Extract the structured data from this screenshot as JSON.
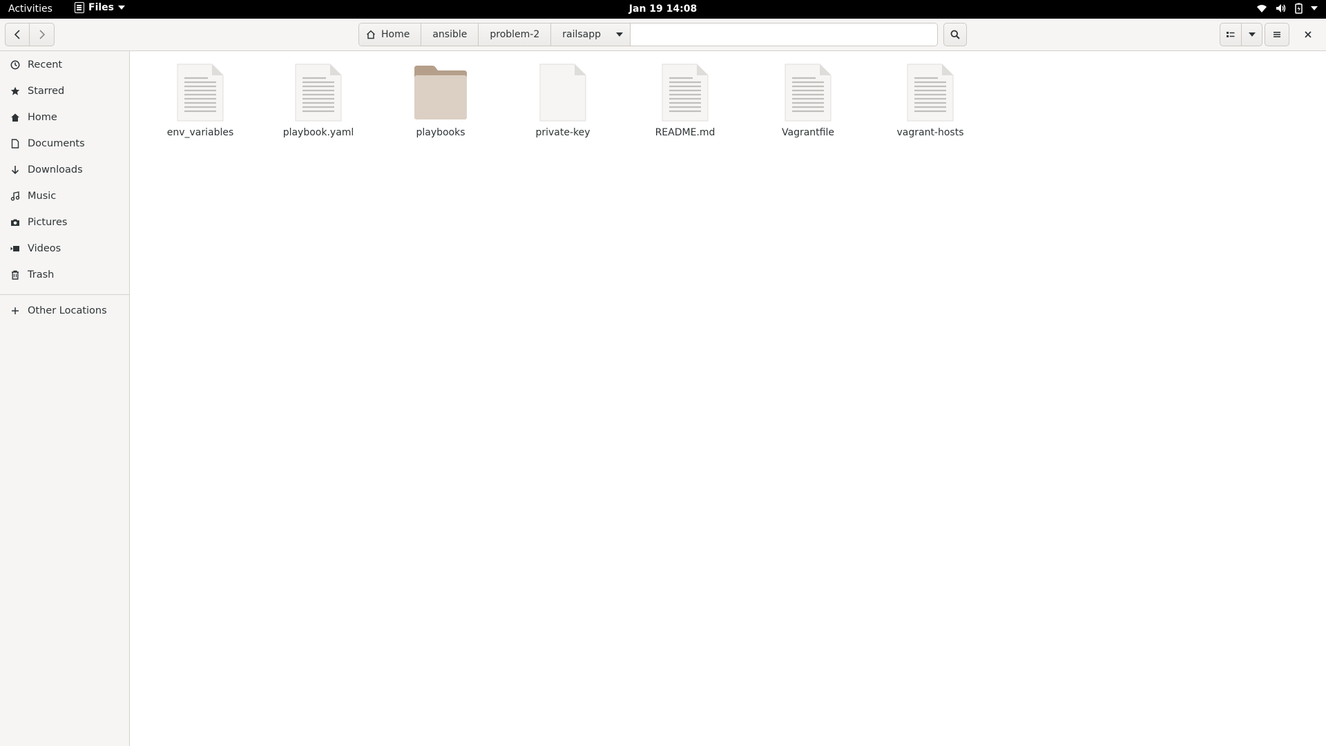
{
  "topbar": {
    "activities": "Activities",
    "app_name": "Files",
    "clock": "Jan 19  14:08",
    "status_icons": [
      "wifi-icon",
      "volume-icon",
      "battery-icon",
      "system-menu-caret-icon"
    ]
  },
  "headerbar": {
    "back_icon": "go-back-icon",
    "forward_icon": "go-forward-icon",
    "path": [
      {
        "label": "Home",
        "icon": "home-icon"
      },
      {
        "label": "ansible"
      },
      {
        "label": "problem-2"
      },
      {
        "label": "railsapp"
      }
    ],
    "search_icon": "search-icon",
    "view_icon": "list-view-icon",
    "view_options_icon": "chevron-down-icon",
    "menu_icon": "hamburger-menu-icon",
    "close_icon": "close-icon"
  },
  "sidebar": {
    "items": [
      {
        "label": "Recent",
        "icon": "clock-icon"
      },
      {
        "label": "Starred",
        "icon": "star-icon"
      },
      {
        "label": "Home",
        "icon": "home-icon"
      },
      {
        "label": "Documents",
        "icon": "document-icon"
      },
      {
        "label": "Downloads",
        "icon": "download-icon"
      },
      {
        "label": "Music",
        "icon": "music-icon"
      },
      {
        "label": "Pictures",
        "icon": "camera-icon"
      },
      {
        "label": "Videos",
        "icon": "video-icon"
      },
      {
        "label": "Trash",
        "icon": "trash-icon"
      }
    ],
    "other_locations": {
      "label": "Other Locations",
      "icon": "plus-icon"
    }
  },
  "files": [
    {
      "name": "env_variables",
      "type": "text"
    },
    {
      "name": "playbook.yaml",
      "type": "text"
    },
    {
      "name": "playbooks",
      "type": "folder"
    },
    {
      "name": "private-key",
      "type": "blank"
    },
    {
      "name": "README.md",
      "type": "text"
    },
    {
      "name": "Vagrantfile",
      "type": "text"
    },
    {
      "name": "vagrant-hosts",
      "type": "text"
    }
  ],
  "colors": {
    "topbar_bg": "#000000",
    "headerbar_bg": "#f6f5f4",
    "sidebar_bg": "#f6f5f4",
    "folder": "#d8cbbf",
    "document": "#f6f5f4"
  }
}
